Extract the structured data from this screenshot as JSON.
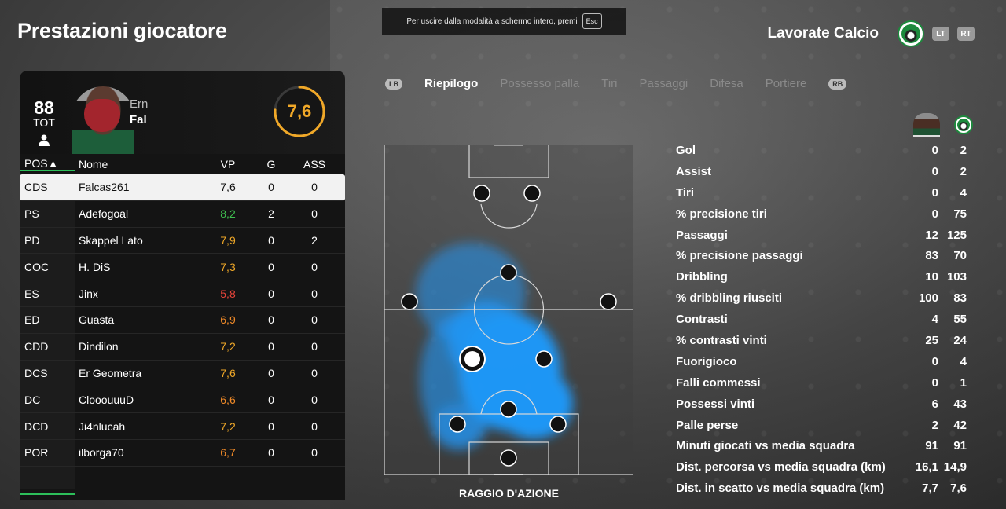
{
  "page_title": "Prestazioni giocatore",
  "fullscreen_notice": {
    "text": "Per uscire dalla modalità a schermo intero, premi",
    "key": "Esc"
  },
  "team": {
    "name": "Lavorate Calcio",
    "lt": "LT",
    "rt": "RT"
  },
  "player": {
    "overall": "88",
    "overall_label": "TOT",
    "first_name": "Ern",
    "last_name": "Fal",
    "rating": "7,6",
    "rating_fraction": 0.76
  },
  "table": {
    "headers": {
      "pos": "POS▲",
      "name": "Nome",
      "vp": "VP",
      "g": "G",
      "ass": "ASS"
    },
    "rows": [
      {
        "pos": "CDS",
        "name": "Falcas261",
        "vp": "7,6",
        "g": "0",
        "ass": "0",
        "color": "#111111"
      },
      {
        "pos": "PS",
        "name": "Adefogoal",
        "vp": "8,2",
        "g": "2",
        "ass": "0",
        "color": "#3fbf4f"
      },
      {
        "pos": "PD",
        "name": "Skappel Lato",
        "vp": "7,9",
        "g": "0",
        "ass": "2",
        "color": "#f0a828"
      },
      {
        "pos": "COC",
        "name": "H. DiS",
        "vp": "7,3",
        "g": "0",
        "ass": "0",
        "color": "#f0a828"
      },
      {
        "pos": "ES",
        "name": "Jinx",
        "vp": "5,8",
        "g": "0",
        "ass": "0",
        "color": "#e8453a"
      },
      {
        "pos": "ED",
        "name": "Guasta",
        "vp": "6,9",
        "g": "0",
        "ass": "0",
        "color": "#f08a28"
      },
      {
        "pos": "CDD",
        "name": "Dindilon",
        "vp": "7,2",
        "g": "0",
        "ass": "0",
        "color": "#f0a828"
      },
      {
        "pos": "DCS",
        "name": "Er Geometra",
        "vp": "7,6",
        "g": "0",
        "ass": "0",
        "color": "#f0a828"
      },
      {
        "pos": "DC",
        "name": "ClooouuuD",
        "vp": "6,6",
        "g": "0",
        "ass": "0",
        "color": "#f08a28"
      },
      {
        "pos": "DCD",
        "name": "Ji4nlucah",
        "vp": "7,2",
        "g": "0",
        "ass": "0",
        "color": "#f0a828"
      },
      {
        "pos": "POR",
        "name": "ilborga70",
        "vp": "6,7",
        "g": "0",
        "ass": "0",
        "color": "#f08a28"
      }
    ]
  },
  "tabs": {
    "lb": "LB",
    "rb": "RB",
    "items": [
      "Riepilogo",
      "Possesso palla",
      "Tiri",
      "Passaggi",
      "Difesa",
      "Portiere"
    ]
  },
  "heatmap_caption": "RAGGIO D'AZIONE",
  "stats": [
    {
      "label": "Gol",
      "player": "0",
      "team": "2"
    },
    {
      "label": "Assist",
      "player": "0",
      "team": "2"
    },
    {
      "label": "Tiri",
      "player": "0",
      "team": "4"
    },
    {
      "label": "% precisione tiri",
      "player": "0",
      "team": "75"
    },
    {
      "label": "Passaggi",
      "player": "12",
      "team": "125"
    },
    {
      "label": "% precisione passaggi",
      "player": "83",
      "team": "70"
    },
    {
      "label": "Dribbling",
      "player": "10",
      "team": "103"
    },
    {
      "label": "% dribbling riusciti",
      "player": "100",
      "team": "83"
    },
    {
      "label": "Contrasti",
      "player": "4",
      "team": "55"
    },
    {
      "label": "% contrasti vinti",
      "player": "25",
      "team": "24"
    },
    {
      "label": "Fuorigioco",
      "player": "0",
      "team": "4"
    },
    {
      "label": "Falli commessi",
      "player": "0",
      "team": "1"
    },
    {
      "label": "Possessi vinti",
      "player": "6",
      "team": "43"
    },
    {
      "label": "Palle perse",
      "player": "2",
      "team": "42"
    },
    {
      "label": "Minuti giocati vs media squadra",
      "player": "91",
      "team": "91"
    },
    {
      "label": "Dist. percorsa vs media squadra (km)",
      "player": "16,1",
      "team": "14,9"
    },
    {
      "label": "Dist. in scatto vs media squadra (km)",
      "player": "7,7",
      "team": "7,6"
    }
  ],
  "colors": {
    "accent_green": "#2dbf5a",
    "rating_orange": "#f0a828",
    "heat_blue": "#1e9bff"
  }
}
